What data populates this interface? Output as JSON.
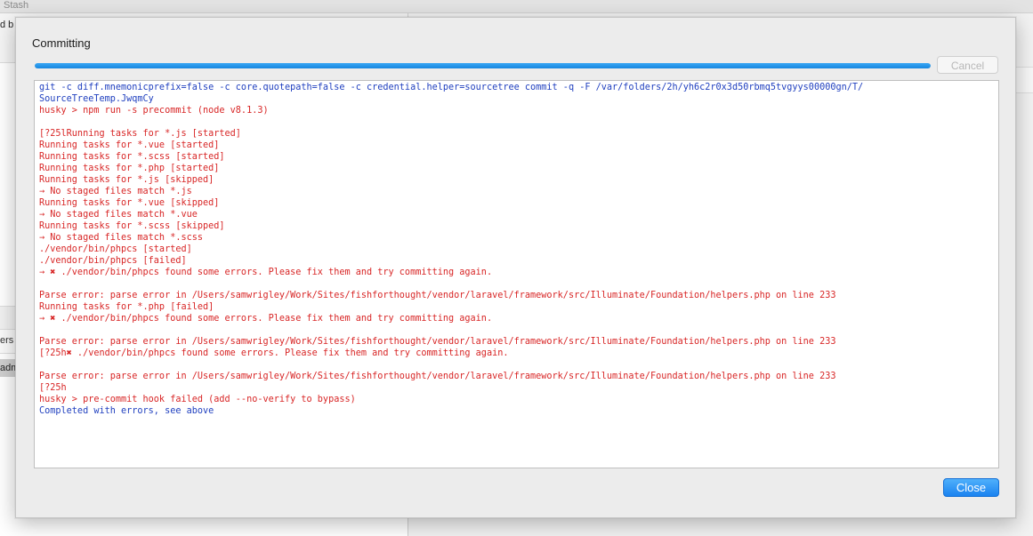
{
  "background": {
    "toolbar_label": "Stash",
    "left_fragment_top": "d b",
    "left_fragment_mid": "ers",
    "left_fragment_sel": "adm"
  },
  "dialog": {
    "title": "Committing",
    "progress_percent": 100,
    "progress_color": "#1a8ae6",
    "cancel_label": "Cancel",
    "close_label": "Close",
    "colors": {
      "cmd": "#1f3fbf",
      "err": "#d82626"
    },
    "log_lines": [
      {
        "text": "git -c diff.mnemonicprefix=false -c core.quotepath=false -c credential.helper=sourcetree commit -q -F /var/folders/2h/yh6c2r0x3d50rbmq5tvgyys00000gn/T/",
        "kind": "cmd"
      },
      {
        "text": "SourceTreeTemp.JwqmCy",
        "kind": "cmd"
      },
      {
        "text": "husky > npm run -s precommit (node v8.1.3)",
        "kind": "err"
      },
      {
        "text": "",
        "kind": "err"
      },
      {
        "text": "[?25lRunning tasks for *.js [started]",
        "kind": "err"
      },
      {
        "text": "Running tasks for *.vue [started]",
        "kind": "err"
      },
      {
        "text": "Running tasks for *.scss [started]",
        "kind": "err"
      },
      {
        "text": "Running tasks for *.php [started]",
        "kind": "err"
      },
      {
        "text": "Running tasks for *.js [skipped]",
        "kind": "err"
      },
      {
        "text": "→ No staged files match *.js",
        "kind": "err"
      },
      {
        "text": "Running tasks for *.vue [skipped]",
        "kind": "err"
      },
      {
        "text": "→ No staged files match *.vue",
        "kind": "err"
      },
      {
        "text": "Running tasks for *.scss [skipped]",
        "kind": "err"
      },
      {
        "text": "→ No staged files match *.scss",
        "kind": "err"
      },
      {
        "text": "./vendor/bin/phpcs [started]",
        "kind": "err"
      },
      {
        "text": "./vendor/bin/phpcs [failed]",
        "kind": "err"
      },
      {
        "text": "→ ✖ ./vendor/bin/phpcs found some errors. Please fix them and try committing again.",
        "kind": "err"
      },
      {
        "text": "",
        "kind": "err"
      },
      {
        "text": "Parse error: parse error in /Users/samwrigley/Work/Sites/fishforthought/vendor/laravel/framework/src/Illuminate/Foundation/helpers.php on line 233",
        "kind": "err"
      },
      {
        "text": "Running tasks for *.php [failed]",
        "kind": "err"
      },
      {
        "text": "→ ✖ ./vendor/bin/phpcs found some errors. Please fix them and try committing again.",
        "kind": "err"
      },
      {
        "text": "",
        "kind": "err"
      },
      {
        "text": "Parse error: parse error in /Users/samwrigley/Work/Sites/fishforthought/vendor/laravel/framework/src/Illuminate/Foundation/helpers.php on line 233",
        "kind": "err"
      },
      {
        "text": "[?25h✖ ./vendor/bin/phpcs found some errors. Please fix them and try committing again.",
        "kind": "err"
      },
      {
        "text": "",
        "kind": "err"
      },
      {
        "text": "Parse error: parse error in /Users/samwrigley/Work/Sites/fishforthought/vendor/laravel/framework/src/Illuminate/Foundation/helpers.php on line 233",
        "kind": "err"
      },
      {
        "text": "[?25h",
        "kind": "err"
      },
      {
        "text": "husky > pre-commit hook failed (add --no-verify to bypass)",
        "kind": "err"
      },
      {
        "text": "Completed with errors, see above",
        "kind": "cmd"
      }
    ]
  }
}
